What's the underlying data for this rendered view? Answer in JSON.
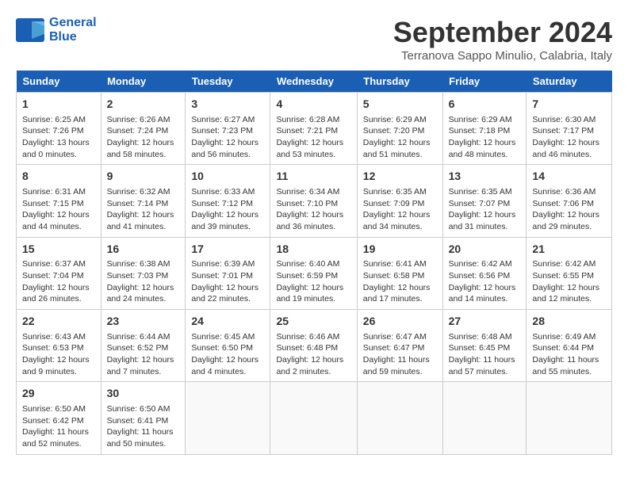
{
  "logo": {
    "line1": "General",
    "line2": "Blue"
  },
  "title": "September 2024",
  "subtitle": "Terranova Sappo Minulio, Calabria, Italy",
  "days_of_week": [
    "Sunday",
    "Monday",
    "Tuesday",
    "Wednesday",
    "Thursday",
    "Friday",
    "Saturday"
  ],
  "weeks": [
    [
      {
        "day": "1",
        "detail": "Sunrise: 6:25 AM\nSunset: 7:26 PM\nDaylight: 13 hours\nand 0 minutes."
      },
      {
        "day": "2",
        "detail": "Sunrise: 6:26 AM\nSunset: 7:24 PM\nDaylight: 12 hours\nand 58 minutes."
      },
      {
        "day": "3",
        "detail": "Sunrise: 6:27 AM\nSunset: 7:23 PM\nDaylight: 12 hours\nand 56 minutes."
      },
      {
        "day": "4",
        "detail": "Sunrise: 6:28 AM\nSunset: 7:21 PM\nDaylight: 12 hours\nand 53 minutes."
      },
      {
        "day": "5",
        "detail": "Sunrise: 6:29 AM\nSunset: 7:20 PM\nDaylight: 12 hours\nand 51 minutes."
      },
      {
        "day": "6",
        "detail": "Sunrise: 6:29 AM\nSunset: 7:18 PM\nDaylight: 12 hours\nand 48 minutes."
      },
      {
        "day": "7",
        "detail": "Sunrise: 6:30 AM\nSunset: 7:17 PM\nDaylight: 12 hours\nand 46 minutes."
      }
    ],
    [
      {
        "day": "8",
        "detail": "Sunrise: 6:31 AM\nSunset: 7:15 PM\nDaylight: 12 hours\nand 44 minutes."
      },
      {
        "day": "9",
        "detail": "Sunrise: 6:32 AM\nSunset: 7:14 PM\nDaylight: 12 hours\nand 41 minutes."
      },
      {
        "day": "10",
        "detail": "Sunrise: 6:33 AM\nSunset: 7:12 PM\nDaylight: 12 hours\nand 39 minutes."
      },
      {
        "day": "11",
        "detail": "Sunrise: 6:34 AM\nSunset: 7:10 PM\nDaylight: 12 hours\nand 36 minutes."
      },
      {
        "day": "12",
        "detail": "Sunrise: 6:35 AM\nSunset: 7:09 PM\nDaylight: 12 hours\nand 34 minutes."
      },
      {
        "day": "13",
        "detail": "Sunrise: 6:35 AM\nSunset: 7:07 PM\nDaylight: 12 hours\nand 31 minutes."
      },
      {
        "day": "14",
        "detail": "Sunrise: 6:36 AM\nSunset: 7:06 PM\nDaylight: 12 hours\nand 29 minutes."
      }
    ],
    [
      {
        "day": "15",
        "detail": "Sunrise: 6:37 AM\nSunset: 7:04 PM\nDaylight: 12 hours\nand 26 minutes."
      },
      {
        "day": "16",
        "detail": "Sunrise: 6:38 AM\nSunset: 7:03 PM\nDaylight: 12 hours\nand 24 minutes."
      },
      {
        "day": "17",
        "detail": "Sunrise: 6:39 AM\nSunset: 7:01 PM\nDaylight: 12 hours\nand 22 minutes."
      },
      {
        "day": "18",
        "detail": "Sunrise: 6:40 AM\nSunset: 6:59 PM\nDaylight: 12 hours\nand 19 minutes."
      },
      {
        "day": "19",
        "detail": "Sunrise: 6:41 AM\nSunset: 6:58 PM\nDaylight: 12 hours\nand 17 minutes."
      },
      {
        "day": "20",
        "detail": "Sunrise: 6:42 AM\nSunset: 6:56 PM\nDaylight: 12 hours\nand 14 minutes."
      },
      {
        "day": "21",
        "detail": "Sunrise: 6:42 AM\nSunset: 6:55 PM\nDaylight: 12 hours\nand 12 minutes."
      }
    ],
    [
      {
        "day": "22",
        "detail": "Sunrise: 6:43 AM\nSunset: 6:53 PM\nDaylight: 12 hours\nand 9 minutes."
      },
      {
        "day": "23",
        "detail": "Sunrise: 6:44 AM\nSunset: 6:52 PM\nDaylight: 12 hours\nand 7 minutes."
      },
      {
        "day": "24",
        "detail": "Sunrise: 6:45 AM\nSunset: 6:50 PM\nDaylight: 12 hours\nand 4 minutes."
      },
      {
        "day": "25",
        "detail": "Sunrise: 6:46 AM\nSunset: 6:48 PM\nDaylight: 12 hours\nand 2 minutes."
      },
      {
        "day": "26",
        "detail": "Sunrise: 6:47 AM\nSunset: 6:47 PM\nDaylight: 11 hours\nand 59 minutes."
      },
      {
        "day": "27",
        "detail": "Sunrise: 6:48 AM\nSunset: 6:45 PM\nDaylight: 11 hours\nand 57 minutes."
      },
      {
        "day": "28",
        "detail": "Sunrise: 6:49 AM\nSunset: 6:44 PM\nDaylight: 11 hours\nand 55 minutes."
      }
    ],
    [
      {
        "day": "29",
        "detail": "Sunrise: 6:50 AM\nSunset: 6:42 PM\nDaylight: 11 hours\nand 52 minutes."
      },
      {
        "day": "30",
        "detail": "Sunrise: 6:50 AM\nSunset: 6:41 PM\nDaylight: 11 hours\nand 50 minutes."
      },
      {
        "day": "",
        "detail": ""
      },
      {
        "day": "",
        "detail": ""
      },
      {
        "day": "",
        "detail": ""
      },
      {
        "day": "",
        "detail": ""
      },
      {
        "day": "",
        "detail": ""
      }
    ]
  ]
}
